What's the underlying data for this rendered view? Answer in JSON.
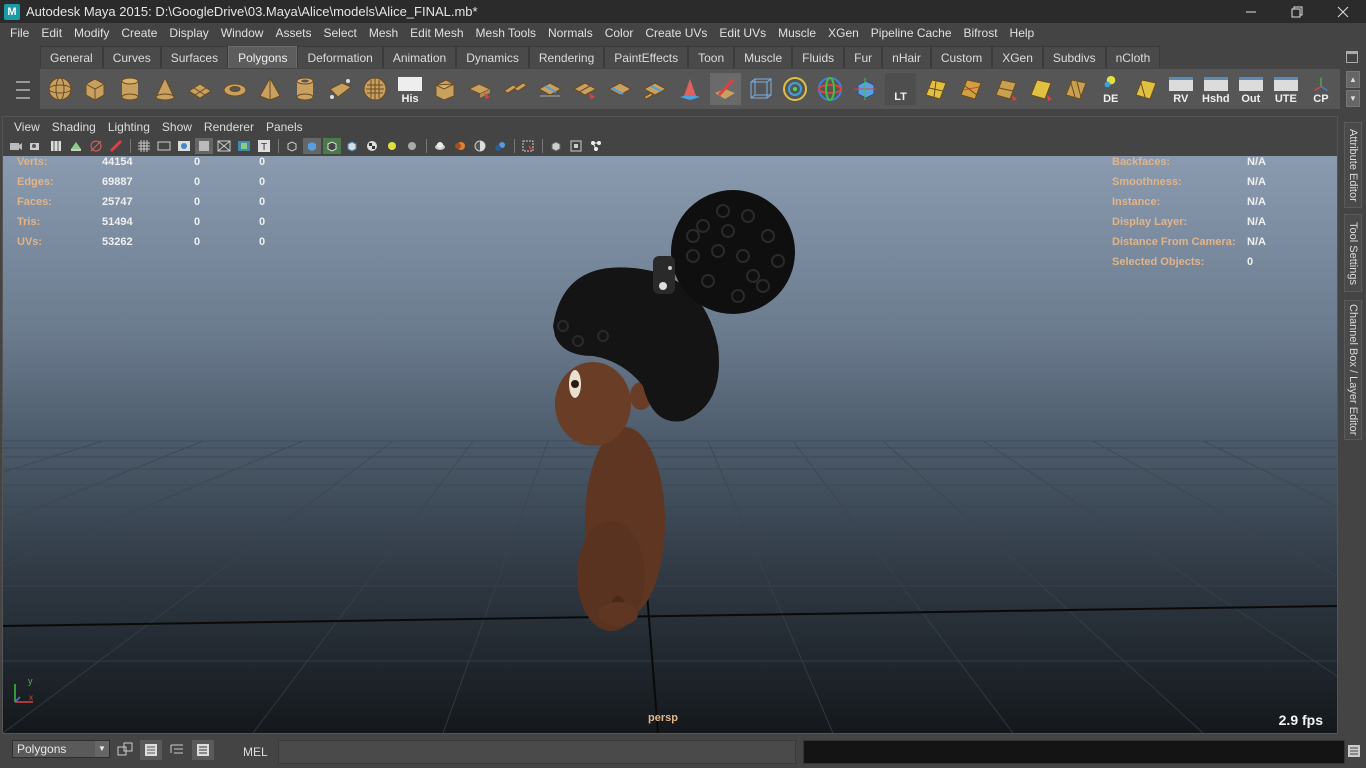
{
  "window": {
    "title": "Autodesk Maya 2015: D:\\GoogleDrive\\03.Maya\\Alice\\models\\Alice_FINAL.mb*",
    "app_icon": "M",
    "controls": [
      "minimize-icon",
      "restore-icon",
      "close-icon"
    ]
  },
  "menubar": [
    "File",
    "Edit",
    "Modify",
    "Create",
    "Display",
    "Window",
    "Assets",
    "Select",
    "Mesh",
    "Edit Mesh",
    "Mesh Tools",
    "Normals",
    "Color",
    "Create UVs",
    "Edit UVs",
    "Muscle",
    "XGen",
    "Pipeline Cache",
    "Bifrost",
    "Help"
  ],
  "shelf": {
    "tabs": [
      "General",
      "Curves",
      "Surfaces",
      "Polygons",
      "Deformation",
      "Animation",
      "Dynamics",
      "Rendering",
      "PaintEffects",
      "Toon",
      "Muscle",
      "Fluids",
      "Fur",
      "nHair",
      "Custom",
      "XGen",
      "Subdivs",
      "nCloth"
    ],
    "active_tab": "Polygons",
    "text_tools": {
      "his": "His",
      "lt": "LT",
      "de": "DE",
      "rv": "RV",
      "hshd": "Hshd",
      "out": "Out",
      "ute": "UTE",
      "cp": "CP"
    }
  },
  "panel": {
    "menus": [
      "View",
      "Shading",
      "Lighting",
      "Show",
      "Renderer",
      "Panels"
    ]
  },
  "hud": {
    "poly_count": [
      {
        "label": "Verts:",
        "v1": "44154",
        "v2": "0",
        "v3": "0"
      },
      {
        "label": "Edges:",
        "v1": "69887",
        "v2": "0",
        "v3": "0"
      },
      {
        "label": "Faces:",
        "v1": "25747",
        "v2": "0",
        "v3": "0"
      },
      {
        "label": "Tris:",
        "v1": "51494",
        "v2": "0",
        "v3": "0"
      },
      {
        "label": "UVs:",
        "v1": "53262",
        "v2": "0",
        "v3": "0"
      }
    ],
    "object_details": [
      {
        "label": "Backfaces:",
        "value": "N/A"
      },
      {
        "label": "Smoothness:",
        "value": "N/A"
      },
      {
        "label": "Instance:",
        "value": "N/A"
      },
      {
        "label": "Display Layer:",
        "value": "N/A"
      },
      {
        "label": "Distance From Camera:",
        "value": "N/A"
      },
      {
        "label": "Selected Objects:",
        "value": "0"
      }
    ],
    "camera": "persp",
    "fps": "2.9 fps",
    "axis_y": "y",
    "axis_x": "x"
  },
  "side_tabs": [
    "Attribute Editor",
    "Tool Settings",
    "Channel Box / Layer Editor"
  ],
  "statusline": {
    "mode": "Polygons",
    "mel_label": "MEL",
    "command_value": ""
  },
  "colors": {
    "hud_label": "#e2b488",
    "active_tab": "#5d5d5d",
    "ui_bg": "#444444"
  }
}
